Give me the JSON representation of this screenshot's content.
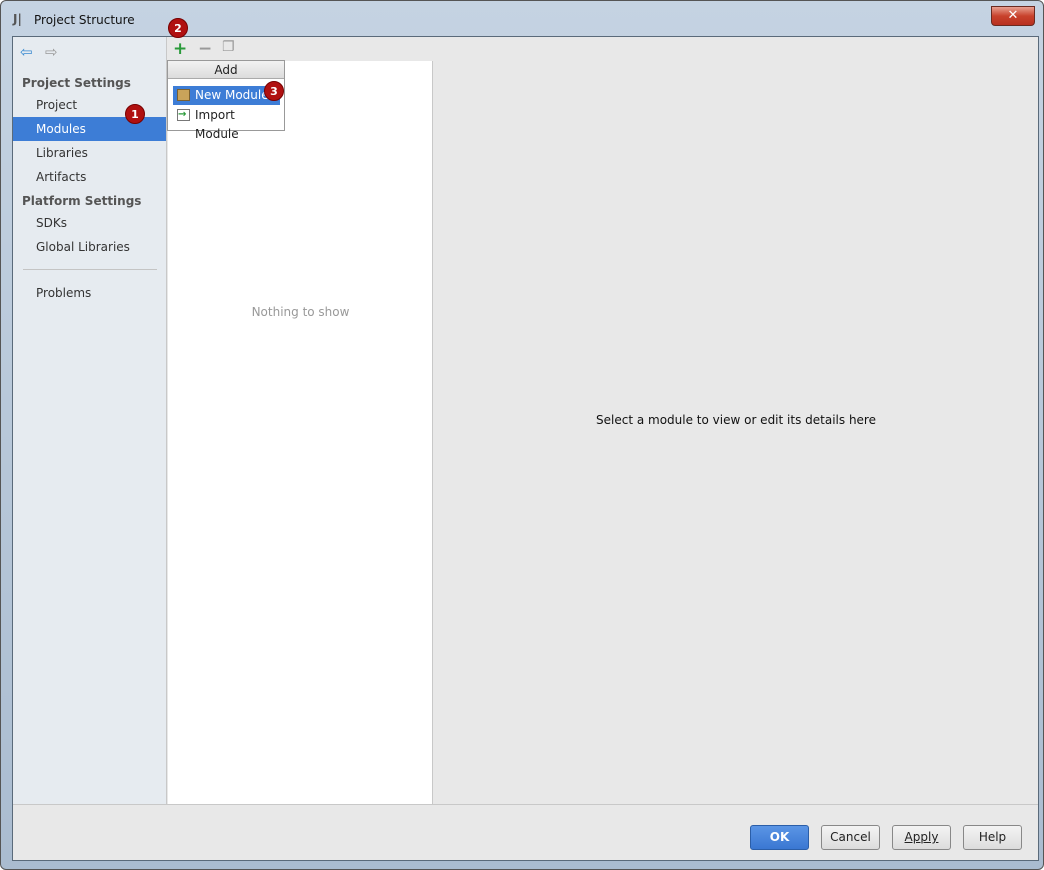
{
  "window": {
    "title": "Project Structure",
    "close_icon": "close-icon"
  },
  "sidebar": {
    "sections": [
      {
        "label": "Project Settings"
      },
      {
        "label": "Platform Settings"
      }
    ],
    "items": [
      {
        "label": "Project"
      },
      {
        "label": "Modules",
        "selected": true
      },
      {
        "label": "Libraries"
      },
      {
        "label": "Artifacts"
      },
      {
        "label": "SDKs"
      },
      {
        "label": "Global Libraries"
      },
      {
        "label": "Problems"
      }
    ]
  },
  "toolbar": {
    "add_icon": "plus-icon",
    "remove_icon": "minus-icon",
    "copy_icon": "copy-icon"
  },
  "popup": {
    "title": "Add",
    "items": [
      {
        "label": "New Module",
        "selected": true
      },
      {
        "label": "Import Module"
      }
    ]
  },
  "middle": {
    "empty_text": "Nothing to show"
  },
  "right": {
    "message": "Select a module to view or edit its details here"
  },
  "badges": [
    "1",
    "2",
    "3"
  ],
  "buttons": {
    "ok": "OK",
    "cancel": "Cancel",
    "apply": "Apply",
    "help": "Help"
  },
  "colors": {
    "selection": "#3d7dd6",
    "badge": "#b01010"
  }
}
